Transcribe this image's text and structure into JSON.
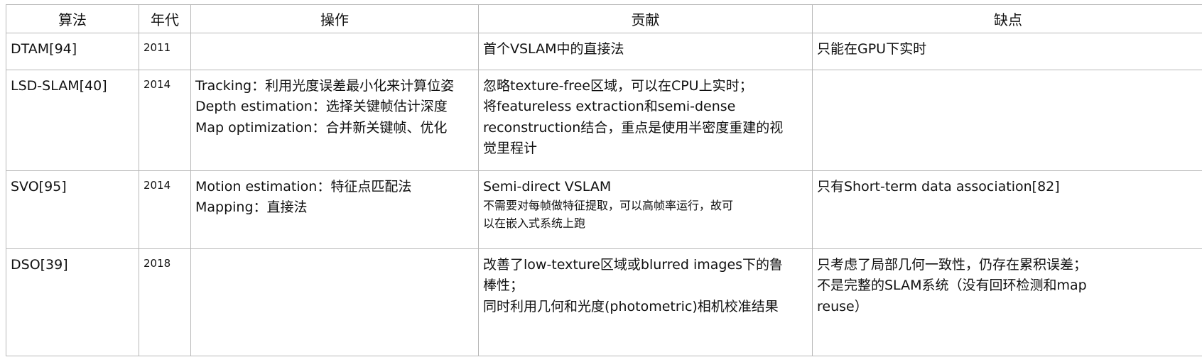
{
  "headers": [
    "算法",
    "年代",
    "操作",
    "贡献",
    "缺点"
  ],
  "rows": [
    {
      "algorithm": "DTAM[94]",
      "year": "2011",
      "operations": [],
      "contributions": [
        "首个VSLAM中的直接法"
      ],
      "drawbacks": [
        "只能在GPU下实时"
      ]
    },
    {
      "algorithm": "LSD-SLAM[40]",
      "year": "2014",
      "operations": [
        "Tracking：利用光度误差最小化来计算位姿",
        "Depth estimation：选择关键帧估计深度",
        "Map optimization：合并新关键帧、优化"
      ],
      "contributions": [
        "忽略texture-free区域，可以在CPU上实时；",
        "将featureless extraction和semi-dense",
        "reconstruction结合，重点是使用半密度重建的视",
        "觉里程计"
      ],
      "drawbacks": []
    },
    {
      "algorithm": "SVO[95]",
      "year": "2014",
      "operations": [
        "Motion estimation：特征点匹配法",
        "Mapping：直接法"
      ],
      "contributions": [
        "Semi-direct VSLAM",
        "不需要对每帧做特征提取，可以高帧率运行，故可",
        "以在嵌入式系统上跑"
      ],
      "drawbacks": [
        "只有Short-term data association[82]"
      ]
    },
    {
      "algorithm": "DSO[39]",
      "year": "2018",
      "operations": [],
      "contributions": [
        "改善了low-texture区域或blurred images下的鲁",
        "棒性；",
        "同时利用几何和光度(photometric)相机校准结果"
      ],
      "drawbacks": [
        "只考虑了局部几何一致性，仍存在累积误差；",
        "不是完整的SLAM系统（没有回环检测和map",
        "reuse）"
      ]
    }
  ]
}
